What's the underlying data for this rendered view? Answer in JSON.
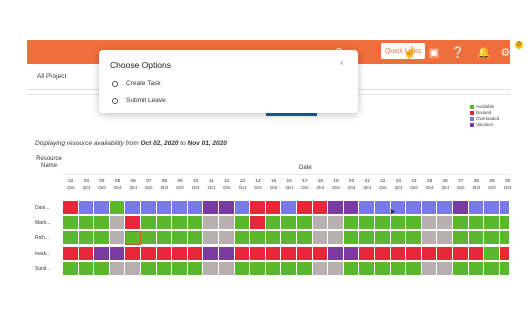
{
  "header": {
    "quick_links_label": "Quick Links",
    "notification_count": "0",
    "icons": [
      "search-icon",
      "hand-pointer-icon",
      "chat-icon",
      "help-icon",
      "bell-icon",
      "settings-icon"
    ]
  },
  "subbar": {
    "project_label": "All Project"
  },
  "legend": [
    {
      "label": "Available",
      "color": "#5bb82c"
    },
    {
      "label": "Booked",
      "color": "#e8283a"
    },
    {
      "label": "Overloaded",
      "color": "#7a7ae6"
    },
    {
      "label": "Vacation",
      "color": "#7a3aa0"
    }
  ],
  "display": {
    "prefix": "Displaying resource availability from",
    "from": "Oct 02, 2020",
    "mid": "to",
    "to": "Nov 01, 2020"
  },
  "grid": {
    "resource_header": "Resource Name",
    "date_header": "Date",
    "days": [
      "02",
      "03",
      "04",
      "05",
      "06",
      "07",
      "08",
      "09",
      "10",
      "11",
      "12",
      "13",
      "14",
      "15",
      "16",
      "17",
      "18",
      "19",
      "20",
      "21",
      "22",
      "23",
      "24",
      "25",
      "26",
      "27",
      "28",
      "29",
      "30"
    ],
    "month": "Oct",
    "rows": [
      {
        "name": "Dani...",
        "cells": "RVVLVVVVVPPVRRVRRPPVVVVVVPVVVVV"
      },
      {
        "name": "Mark...",
        "cells": "GGGGRGGGGGGGRGGGGGGGGGGGGGGGGG"
      },
      {
        "name": "Rich...",
        "cells": "GGGGHGGGGGGGGGGGGGGGGGGGGGGGGG"
      },
      {
        "name": "mark...",
        "cells": "RRPPRRRRRPPRRRRRRPPRRRRRRRRGRR"
      },
      {
        "name": "Sunil...",
        "cells": "GGGGGGGGGGGGGGGGGGGGGGGGGGGGGG"
      }
    ]
  },
  "modal": {
    "title": "Choose Options",
    "close_symbol": "×",
    "options": [
      "Create Task",
      "Submit Leave"
    ]
  }
}
